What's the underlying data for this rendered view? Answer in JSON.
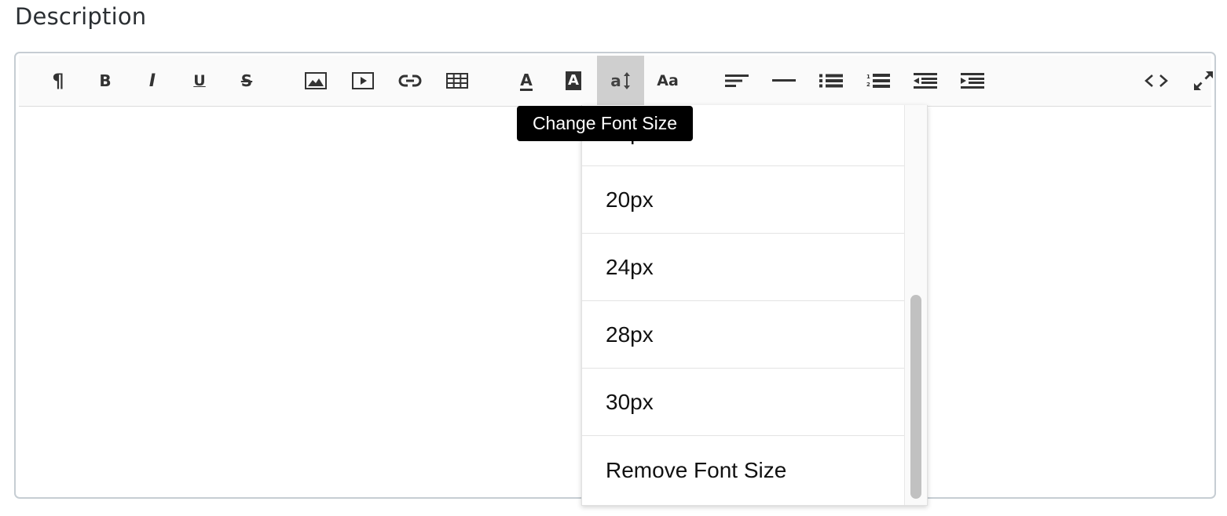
{
  "section_title": "Description",
  "toolbar": {
    "buttons": [
      {
        "name": "paragraph-icon",
        "glyph": "¶"
      },
      {
        "name": "bold-icon",
        "glyph": "B"
      },
      {
        "name": "italic-icon",
        "glyph": "I"
      },
      {
        "name": "underline-icon",
        "glyph": "U"
      },
      {
        "name": "strikethrough-icon",
        "glyph": "S"
      },
      {
        "name": "image-icon"
      },
      {
        "name": "video-icon"
      },
      {
        "name": "link-icon"
      },
      {
        "name": "table-icon"
      },
      {
        "name": "text-color-icon",
        "glyph": "A"
      },
      {
        "name": "background-color-icon",
        "glyph": "A"
      },
      {
        "name": "font-size-icon",
        "glyph": "a",
        "active": true
      },
      {
        "name": "font-family-icon",
        "glyph": "Aa"
      },
      {
        "name": "align-left-icon"
      },
      {
        "name": "horizontal-rule-icon"
      },
      {
        "name": "bullet-list-icon"
      },
      {
        "name": "numbered-list-icon"
      },
      {
        "name": "outdent-icon"
      },
      {
        "name": "indent-icon"
      },
      {
        "name": "code-view-icon"
      },
      {
        "name": "fullscreen-icon"
      }
    ],
    "active_color": "#cfcfcf"
  },
  "font_size_menu": {
    "partial_item": "18px",
    "items": [
      "20px",
      "24px",
      "28px",
      "30px",
      "Remove Font Size"
    ]
  },
  "tooltip": "Change Font Size"
}
